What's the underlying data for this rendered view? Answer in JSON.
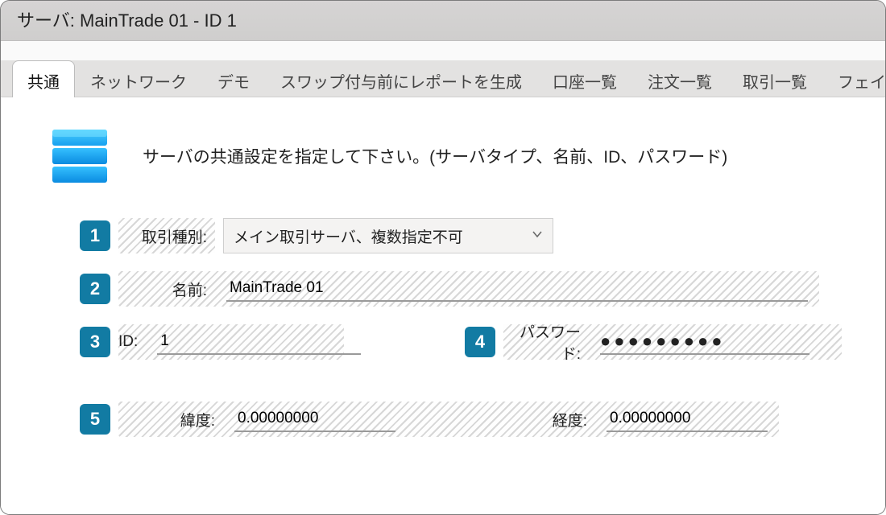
{
  "window": {
    "title": "サーバ: MainTrade 01 - ID  1"
  },
  "tabs": [
    {
      "label": "共通",
      "active": true
    },
    {
      "label": "ネットワーク"
    },
    {
      "label": "デモ"
    },
    {
      "label": "スワップ付与前にレポートを生成"
    },
    {
      "label": "口座一覧"
    },
    {
      "label": "注文一覧"
    },
    {
      "label": "取引一覧"
    },
    {
      "label": "フェイ"
    }
  ],
  "intro": {
    "text": "サーバの共通設定を指定して下さい。(サーバタイプ、名前、ID、パスワード)"
  },
  "badges": {
    "r1": "1",
    "r2": "2",
    "r3": "3",
    "r4": "4",
    "r5": "5"
  },
  "labels": {
    "trade_type": "取引種別:",
    "name": "名前:",
    "id": "ID:",
    "password": "パスワード:",
    "latitude": "緯度:",
    "longitude": "経度:"
  },
  "values": {
    "trade_type": "メイン取引サーバ、複数指定不可",
    "name": "MainTrade 01",
    "id": "1",
    "password_masked": "●●●●●●●●●",
    "latitude": "0.00000000",
    "longitude": "0.00000000"
  }
}
